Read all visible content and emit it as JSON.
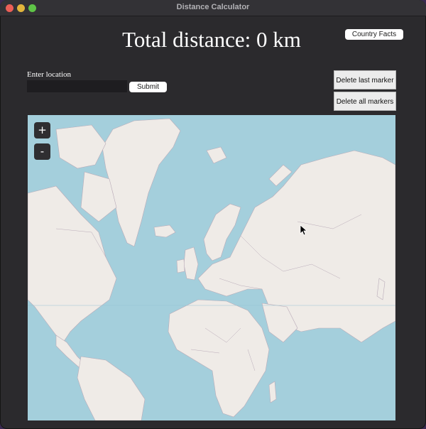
{
  "window": {
    "title": "Distance Calculator"
  },
  "header": {
    "total_distance": "Total distance: 0 km",
    "country_facts_label": "Country Facts"
  },
  "location": {
    "label": "Enter location",
    "value": "",
    "submit_label": "Submit"
  },
  "markers": {
    "delete_last_label": "Delete last marker",
    "delete_all_label": "Delete all markers"
  },
  "map": {
    "zoom_in_label": "+",
    "zoom_out_label": "-",
    "water_color": "#a4cfdc",
    "land_color": "#efebe7",
    "border_color": "#b9abb8"
  }
}
